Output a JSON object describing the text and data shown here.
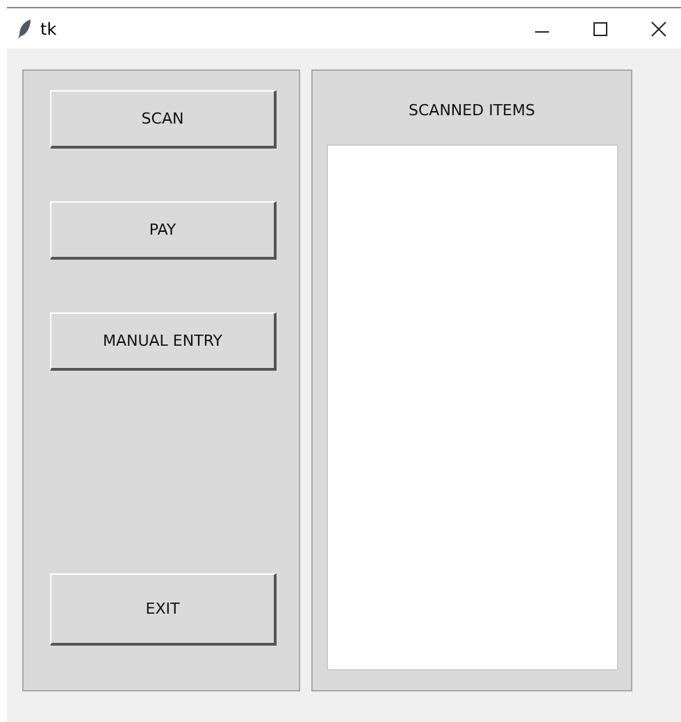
{
  "window": {
    "title": "tk"
  },
  "buttons": [
    {
      "label": "SCAN"
    },
    {
      "label": "PAY"
    },
    {
      "label": "MANUAL ENTRY"
    },
    {
      "label": "EXIT"
    }
  ],
  "scanned_items": {
    "title": "SCANNED ITEMS"
  }
}
